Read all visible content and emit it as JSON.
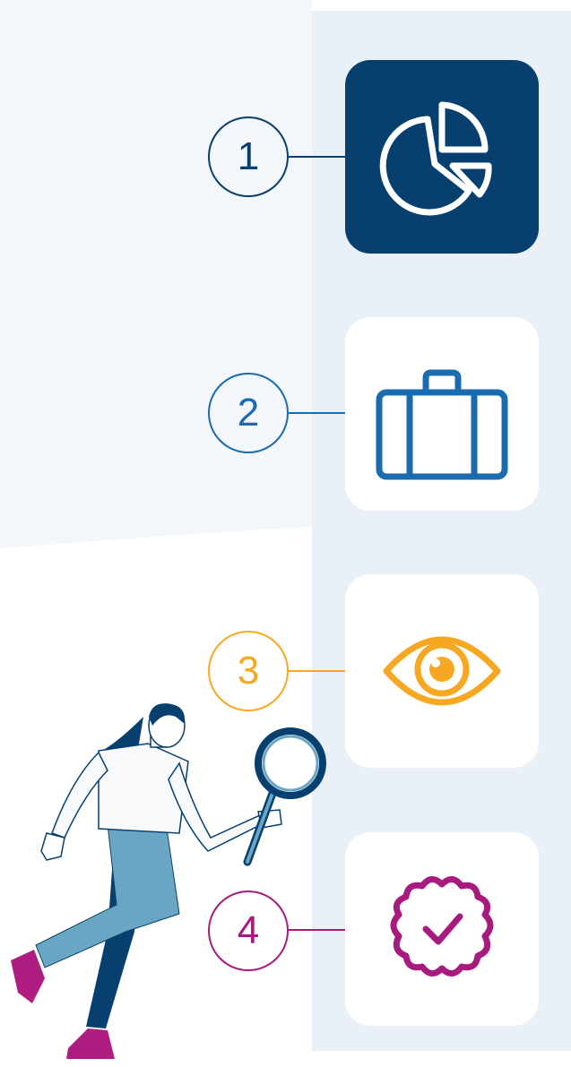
{
  "colors": {
    "navy": "#07406e",
    "blue": "#1a6bb0",
    "orange": "#f7a823",
    "magenta": "#a81b7e",
    "panel": "#e9f0f8",
    "light_bg": "#f3f6fa"
  },
  "steps": [
    {
      "number": "1",
      "icon": "pie-chart-icon",
      "color": "#07406e",
      "active": true
    },
    {
      "number": "2",
      "icon": "briefcase-icon",
      "color": "#1a6bb0",
      "active": false
    },
    {
      "number": "3",
      "icon": "eye-icon",
      "color": "#f7a823",
      "active": false
    },
    {
      "number": "4",
      "icon": "verified-badge-icon",
      "color": "#a81b7e",
      "active": false
    }
  ],
  "illustration": "woman-with-magnifying-glass"
}
